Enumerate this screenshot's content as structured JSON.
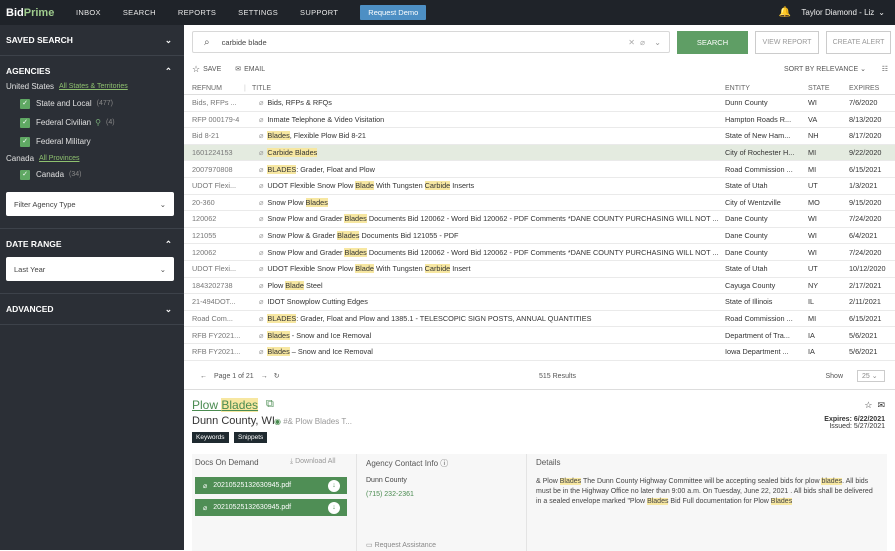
{
  "topbar": {
    "logo_a": "Bid",
    "logo_b": "Prime",
    "nav": [
      "INBOX",
      "SEARCH",
      "REPORTS",
      "SETTINGS",
      "SUPPORT"
    ],
    "demo": "Request Demo",
    "user": "Taylor Diamond - Liz"
  },
  "sidebar": {
    "saved_search": "SAVED SEARCH",
    "agencies": "AGENCIES",
    "us": "United States",
    "us_link": "All States & Territories",
    "us_items": [
      {
        "label": "State and Local",
        "count": "(477)"
      },
      {
        "label": "Federal Civilian",
        "count": "(4)"
      },
      {
        "label": "Federal Military",
        "count": ""
      }
    ],
    "canada": "Canada",
    "canada_link": "All Provinces",
    "canada_items": [
      {
        "label": "Canada",
        "count": "(34)"
      }
    ],
    "agency_filter": "Filter Agency Type",
    "date_range": "DATE RANGE",
    "date_value": "Last Year",
    "advanced": "ADVANCED"
  },
  "search": {
    "query": "carbide blade",
    "search_btn": "SEARCH",
    "view_report": "VIEW REPORT",
    "create_alert": "CREATE ALERT"
  },
  "actions": {
    "save": "SAVE",
    "email": "EMAIL",
    "sort": "SORT BY RELEVANCE"
  },
  "table": {
    "headers": {
      "ref": "REFNUM",
      "title": "TITLE",
      "entity": "ENTITY",
      "state": "STATE",
      "expires": "EXPIRES"
    },
    "rows": [
      {
        "ref": "Bids, RFPs ...",
        "pre": "Bids, RFPs & RFQs",
        "hl": "",
        "post": "",
        "entity": "Dunn County",
        "state": "WI",
        "exp": "7/6/2020"
      },
      {
        "ref": "RFP 000179-4",
        "pre": "Inmate Telephone & Video Visitation",
        "hl": "",
        "post": "",
        "entity": "Hampton Roads R...",
        "state": "VA",
        "exp": "8/13/2020"
      },
      {
        "ref": "Bid 8-21",
        "pre": "",
        "hl": "Blades",
        "post": ", Flexible Plow Bid 8-21",
        "entity": "State of New Ham...",
        "state": "NH",
        "exp": "8/17/2020"
      },
      {
        "ref": "1601224153",
        "pre": "",
        "hl": "Carbide Blades",
        "post": "",
        "entity": "City of Rochester H...",
        "state": "MI",
        "exp": "9/22/2020"
      },
      {
        "ref": "2007970808",
        "pre": "",
        "hl": "BLADES",
        "post": ": Grader, Float and Plow",
        "entity": "Road Commission ...",
        "state": "MI",
        "exp": "6/15/2021"
      },
      {
        "ref": "UDOT Flexi...",
        "pre": "UDOT Flexible Snow Plow ",
        "hl": "Blade",
        "post": " With Tungsten ",
        "hl2": "Carbide",
        "post2": " Inserts",
        "entity": "State of Utah",
        "state": "UT",
        "exp": "1/3/2021"
      },
      {
        "ref": "20-360",
        "pre": "Snow Plow ",
        "hl": "Blades",
        "post": "",
        "entity": "City of Wentzville",
        "state": "MO",
        "exp": "9/15/2020"
      },
      {
        "ref": "120062",
        "pre": "Snow Plow and Grader ",
        "hl": "Blades",
        "post": " Documents Bid 120062 - Word Bid 120062 - PDF Comments *DANE COUNTY PURCHASING WILL NOT ...",
        "entity": "Dane County",
        "state": "WI",
        "exp": "7/24/2020"
      },
      {
        "ref": "121055",
        "pre": "Snow Plow & Grader ",
        "hl": "Blades",
        "post": " Documents Bid 121055 - PDF",
        "entity": "Dane County",
        "state": "WI",
        "exp": "6/4/2021"
      },
      {
        "ref": "120062",
        "pre": "Snow Plow and Grader ",
        "hl": "Blades",
        "post": " Documents Bid 120062 - Word Bid 120062 - PDF Comments *DANE COUNTY PURCHASING WILL NOT ...",
        "entity": "Dane County",
        "state": "WI",
        "exp": "7/24/2020"
      },
      {
        "ref": "UDOT Flexi...",
        "pre": "UDOT Flexible Snow Plow ",
        "hl": "Blade",
        "post": " With Tungsten ",
        "hl2": "Carbide",
        "post2": " Insert",
        "entity": "State of Utah",
        "state": "UT",
        "exp": "10/12/2020"
      },
      {
        "ref": "1843202738",
        "pre": "Plow ",
        "hl": "Blade",
        "post": " Steel",
        "entity": "Cayuga County",
        "state": "NY",
        "exp": "2/17/2021"
      },
      {
        "ref": "21-494DOT...",
        "pre": "IDOT Snowplow Cutting Edges",
        "hl": "",
        "post": "",
        "entity": "State of Illinois",
        "state": "IL",
        "exp": "2/11/2021"
      },
      {
        "ref": "Road Com...",
        "pre": "",
        "hl": "BLADES",
        "post": ": Grader, Float and Plow and 1385.1 - TELESCOPIC SIGN POSTS, ANNUAL QUANTITIES",
        "entity": "Road Commission ...",
        "state": "MI",
        "exp": "6/15/2021"
      },
      {
        "ref": "RFB FY2021...",
        "pre": "",
        "hl": "Blades",
        "post": " - Snow and Ice Removal",
        "entity": "Department of Tra...",
        "state": "IA",
        "exp": "5/6/2021"
      },
      {
        "ref": "RFB FY2021...",
        "pre": "",
        "hl": "Blades",
        "post": " – Snow and Ice Removal",
        "entity": "Iowa Department ...",
        "state": "IA",
        "exp": "5/6/2021"
      }
    ]
  },
  "pager": {
    "page": "Page 1 of 21",
    "results": "515 Results",
    "show": "Show",
    "size": "25"
  },
  "detail": {
    "title_a": "Plow ",
    "title_b": "Blades",
    "location": "Dunn County, WI",
    "subtitle": "#& Plow Blades T...",
    "tags": [
      "Keywords",
      "Snippets"
    ],
    "expires": "Expires: 6/22/2021",
    "issued": "Issued: 5/27/2021",
    "docs_head": "Docs On Demand",
    "download_all": "Download All",
    "files": [
      "20210525132630945.pdf",
      "20210525132630945.pdf"
    ],
    "contact_head": "Agency Contact Info",
    "contact_name": "Dunn County",
    "contact_phone": "(715) 232-2361",
    "details_head": "Details",
    "details_text": [
      {
        "t": "& Plow ",
        "h": false
      },
      {
        "t": "Blades",
        "h": true
      },
      {
        "t": " The Dunn County Highway Committee will be accepting sealed bids for plow ",
        "h": false
      },
      {
        "t": "blades",
        "h": true
      },
      {
        "t": ". All bids must be in the Highway Office no later than 9:00 a.m. On Tuesday, June 22, 2021 . All bids shall be delivered in a sealed envelope marked \"Plow ",
        "h": false
      },
      {
        "t": "Blades",
        "h": true
      },
      {
        "t": " Bid Full documentation for Plow ",
        "h": false
      },
      {
        "t": "Blades",
        "h": true
      }
    ],
    "request": "Request Assistance"
  }
}
